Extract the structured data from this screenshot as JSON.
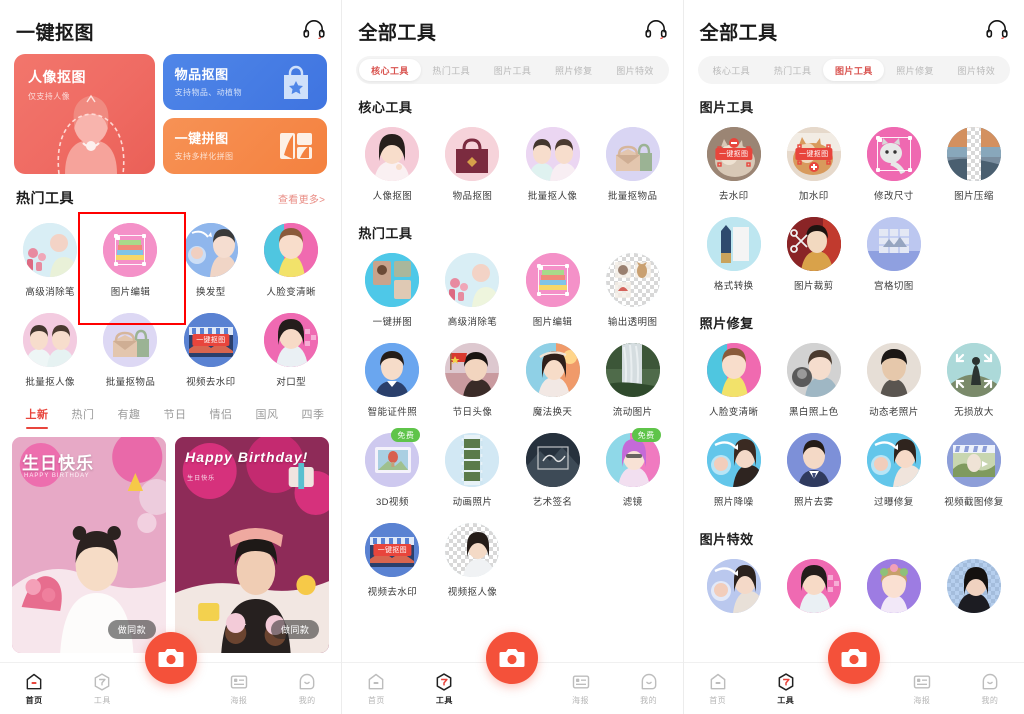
{
  "app": {
    "accent_red": "#e8453c",
    "accent_pink": "#e98c84",
    "camera_button_color": "#f4513a",
    "free_badge_color": "#5fc44a"
  },
  "screen1": {
    "header": {
      "title": "一键抠图",
      "support_icon": "headset-icon"
    },
    "banners": {
      "primary": {
        "title": "人像抠图",
        "subtitle": "仅支持人像"
      },
      "secondary": [
        {
          "title": "物品抠图",
          "subtitle": "支持物品、动植物",
          "icon": "shopping-bag-star-icon"
        },
        {
          "title": "一键拼图",
          "subtitle": "支持多样化拼图",
          "icon": "collage-icon"
        }
      ]
    },
    "hot_tools": {
      "section_title": "热门工具",
      "more_label": "查看更多>",
      "items": [
        {
          "label": "高级消除笔"
        },
        {
          "label": "图片编辑"
        },
        {
          "label": "换发型"
        },
        {
          "label": "人脸变清晰"
        },
        {
          "label": "批量抠人像"
        },
        {
          "label": "批量抠物品"
        },
        {
          "label": "视频去水印"
        },
        {
          "label": "对口型"
        }
      ],
      "highlighted_item": "图片编辑"
    },
    "category_tabs": {
      "active": "上新",
      "items": [
        "上新",
        "热门",
        "有趣",
        "节日",
        "情侣",
        "国风",
        "四季"
      ]
    },
    "templates": [
      {
        "title": "生日快乐",
        "subtitle": "HAPPY BIRTHDAY",
        "action_label": "做同款"
      },
      {
        "title": "Happy Birthday!",
        "subtitle": "生日快乐",
        "action_label": "做同款"
      }
    ],
    "nav": {
      "active": "首页",
      "items": [
        {
          "label": "首页",
          "icon": "home-icon"
        },
        {
          "label": "工具",
          "icon": "tools-hex-icon"
        },
        {
          "label": "海报",
          "icon": "poster-icon"
        },
        {
          "label": "我的",
          "icon": "profile-icon"
        }
      ],
      "camera_label": "camera-icon"
    }
  },
  "screen2": {
    "header": {
      "title": "全部工具",
      "support_icon": "headset-icon"
    },
    "tabs": {
      "active": "核心工具",
      "items": [
        "核心工具",
        "热门工具",
        "图片工具",
        "照片修复",
        "图片特效"
      ]
    },
    "groups": [
      {
        "title": "核心工具",
        "items": [
          {
            "label": "人像抠图"
          },
          {
            "label": "物品抠图"
          },
          {
            "label": "批量抠人像"
          },
          {
            "label": "批量抠物品"
          }
        ]
      },
      {
        "title": "热门工具",
        "items": [
          {
            "label": "一键拼图"
          },
          {
            "label": "高级消除笔"
          },
          {
            "label": "图片编辑"
          },
          {
            "label": "输出透明图"
          },
          {
            "label": "智能证件照"
          },
          {
            "label": "节日头像"
          },
          {
            "label": "魔法换天"
          },
          {
            "label": "流动图片"
          },
          {
            "label": "3D视频",
            "badge": "免费"
          },
          {
            "label": "动画照片"
          },
          {
            "label": "艺术签名"
          },
          {
            "label": "滤镜",
            "badge": "免费"
          },
          {
            "label": "视频去水印"
          },
          {
            "label": "视频抠人像"
          }
        ]
      }
    ],
    "nav": {
      "active": "工具",
      "items": [
        {
          "label": "首页",
          "icon": "home-icon"
        },
        {
          "label": "工具",
          "icon": "tools-hex-icon"
        },
        {
          "label": "海报",
          "icon": "poster-icon"
        },
        {
          "label": "我的",
          "icon": "profile-icon"
        }
      ],
      "camera_label": "camera-icon"
    }
  },
  "screen3": {
    "header": {
      "title": "全部工具",
      "support_icon": "headset-icon"
    },
    "tabs": {
      "active": "图片工具",
      "items": [
        "核心工具",
        "热门工具",
        "图片工具",
        "照片修复",
        "图片特效"
      ]
    },
    "groups": [
      {
        "title": "图片工具",
        "items": [
          {
            "label": "去水印"
          },
          {
            "label": "加水印"
          },
          {
            "label": "修改尺寸"
          },
          {
            "label": "图片压缩"
          },
          {
            "label": "格式转换"
          },
          {
            "label": "图片裁剪"
          },
          {
            "label": "宫格切图"
          }
        ]
      },
      {
        "title": "照片修复",
        "items": [
          {
            "label": "人脸变清晰"
          },
          {
            "label": "黑白照上色"
          },
          {
            "label": "动态老照片"
          },
          {
            "label": "无损放大"
          },
          {
            "label": "照片降噪"
          },
          {
            "label": "照片去雾"
          },
          {
            "label": "过曝修复"
          },
          {
            "label": "视频截图修复"
          }
        ]
      },
      {
        "title": "图片特效",
        "items": [
          {
            "label": ""
          },
          {
            "label": ""
          },
          {
            "label": ""
          },
          {
            "label": ""
          }
        ]
      }
    ],
    "nav": {
      "active": "工具",
      "items": [
        {
          "label": "首页",
          "icon": "home-icon"
        },
        {
          "label": "工具",
          "icon": "tools-hex-icon"
        },
        {
          "label": "海报",
          "icon": "poster-icon"
        },
        {
          "label": "我的",
          "icon": "profile-icon"
        }
      ],
      "camera_label": "camera-icon"
    }
  }
}
